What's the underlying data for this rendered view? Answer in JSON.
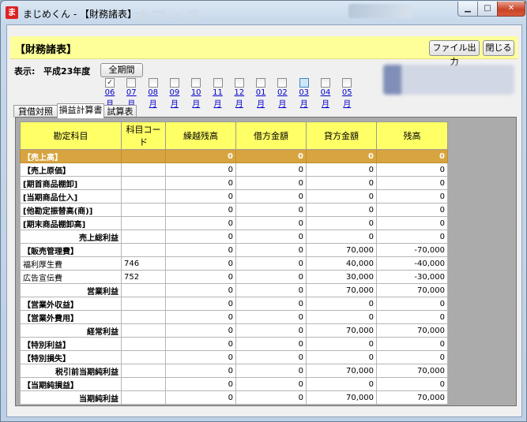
{
  "window": {
    "app_icon": "ま",
    "title": "まじめくん - 【財務諸表】",
    "bg_text": "オフィス",
    "minimize_icon": "minimize-icon",
    "maximize_icon": "maximize-icon",
    "close_icon": "close-icon"
  },
  "header": {
    "title": "【財務諸表】",
    "export_label": "ファイル出力",
    "close_label": "閉じる"
  },
  "filter": {
    "display_label": "表示:",
    "period": "平成23年度",
    "all_period_label": "全期間",
    "months": [
      {
        "label": "06月",
        "checked": true
      },
      {
        "label": "07月",
        "checked": false
      },
      {
        "label": "08月",
        "checked": false
      },
      {
        "label": "09月",
        "checked": false
      },
      {
        "label": "10月",
        "checked": false
      },
      {
        "label": "11月",
        "checked": false
      },
      {
        "label": "12月",
        "checked": false
      },
      {
        "label": "01月",
        "checked": false
      },
      {
        "label": "02月",
        "checked": false
      },
      {
        "label": "03月",
        "checked": false
      },
      {
        "label": "04月",
        "checked": false
      },
      {
        "label": "05月",
        "checked": false
      }
    ]
  },
  "tabs": [
    "貸借対照表",
    "損益計算書",
    "試算表"
  ],
  "active_tab": 1,
  "table": {
    "columns": [
      "勘定科目",
      "科目コード",
      "繰越残高",
      "借方金額",
      "貸方金額",
      "残高"
    ],
    "rows": [
      {
        "name": "【売上高】",
        "code": "",
        "carry": "0",
        "debit": "0",
        "credit": "0",
        "balance": "0",
        "type": "head",
        "selected": true
      },
      {
        "name": "【売上原価】",
        "code": "",
        "carry": "0",
        "debit": "0",
        "credit": "0",
        "balance": "0",
        "type": "head"
      },
      {
        "name": "[期首商品棚卸]",
        "code": "",
        "carry": "0",
        "debit": "0",
        "credit": "0",
        "balance": "0",
        "type": "sub1"
      },
      {
        "name": "[当期商品仕入]",
        "code": "",
        "carry": "0",
        "debit": "0",
        "credit": "0",
        "balance": "0",
        "type": "sub1"
      },
      {
        "name": "[他勘定振替高(商)]",
        "code": "",
        "carry": "0",
        "debit": "0",
        "credit": "0",
        "balance": "0",
        "type": "sub1"
      },
      {
        "name": "[期末商品棚卸高]",
        "code": "",
        "carry": "0",
        "debit": "0",
        "credit": "0",
        "balance": "0",
        "type": "sub1"
      },
      {
        "name": "売上総利益",
        "code": "",
        "carry": "0",
        "debit": "0",
        "credit": "0",
        "balance": "0",
        "type": "total"
      },
      {
        "name": "【販売管理費】",
        "code": "",
        "carry": "0",
        "debit": "0",
        "credit": "70,000",
        "balance": "-70,000",
        "type": "head"
      },
      {
        "name": "福利厚生費",
        "code": "746",
        "carry": "0",
        "debit": "0",
        "credit": "40,000",
        "balance": "-40,000",
        "type": "item"
      },
      {
        "name": "広告宣伝費",
        "code": "752",
        "carry": "0",
        "debit": "0",
        "credit": "30,000",
        "balance": "-30,000",
        "type": "item"
      },
      {
        "name": "営業利益",
        "code": "",
        "carry": "0",
        "debit": "0",
        "credit": "70,000",
        "balance": "70,000",
        "type": "total"
      },
      {
        "name": "【営業外収益】",
        "code": "",
        "carry": "0",
        "debit": "0",
        "credit": "0",
        "balance": "0",
        "type": "head"
      },
      {
        "name": "【営業外費用】",
        "code": "",
        "carry": "0",
        "debit": "0",
        "credit": "0",
        "balance": "0",
        "type": "head"
      },
      {
        "name": "経常利益",
        "code": "",
        "carry": "0",
        "debit": "0",
        "credit": "70,000",
        "balance": "70,000",
        "type": "total"
      },
      {
        "name": "【特別利益】",
        "code": "",
        "carry": "0",
        "debit": "0",
        "credit": "0",
        "balance": "0",
        "type": "head"
      },
      {
        "name": "【特別損失】",
        "code": "",
        "carry": "0",
        "debit": "0",
        "credit": "0",
        "balance": "0",
        "type": "head"
      },
      {
        "name": "税引前当期純利益",
        "code": "",
        "carry": "0",
        "debit": "0",
        "credit": "70,000",
        "balance": "70,000",
        "type": "total"
      },
      {
        "name": "【当期純損益】",
        "code": "",
        "carry": "0",
        "debit": "0",
        "credit": "0",
        "balance": "0",
        "type": "head"
      },
      {
        "name": "当期純利益",
        "code": "",
        "carry": "0",
        "debit": "0",
        "credit": "70,000",
        "balance": "70,000",
        "type": "total"
      }
    ]
  }
}
